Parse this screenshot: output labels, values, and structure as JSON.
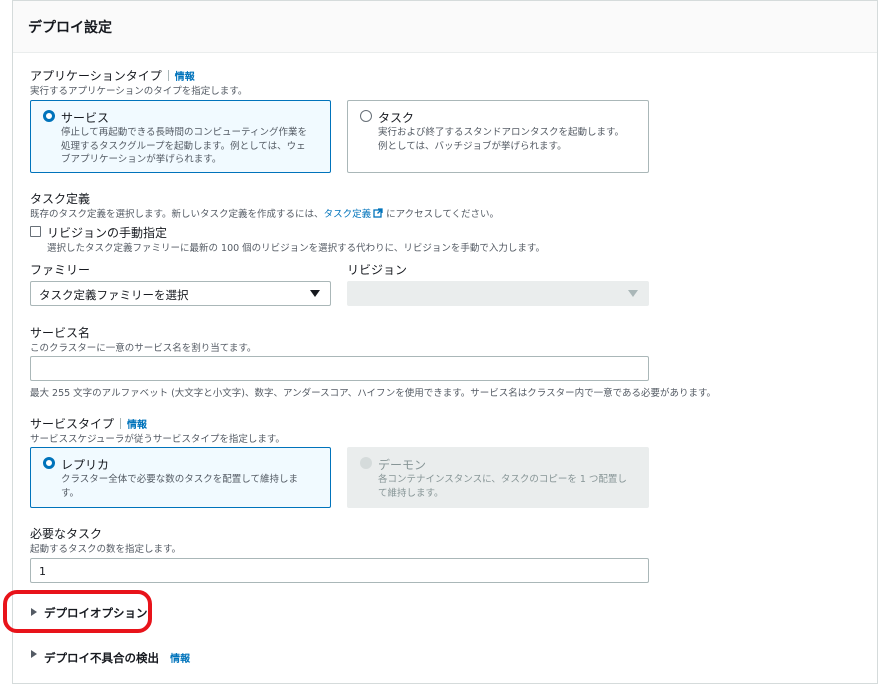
{
  "panel": {
    "title": "デプロイ設定"
  },
  "app_type": {
    "label": "アプリケーションタイプ",
    "info": "情報",
    "description": "実行するアプリケーションのタイプを指定します。",
    "options": [
      {
        "title": "サービス",
        "lines": [
          "停止して再起動できる長時間のコンピューティング作業を",
          "処理するタスクグループを起動します。例としては、ウェ",
          "ブアプリケーションが挙げられます。"
        ],
        "selected": true
      },
      {
        "title": "タスク",
        "lines": [
          "実行および終了するスタンドアロンタスクを起動します。",
          "例としては、バッチジョブが挙げられます。"
        ],
        "selected": false
      }
    ]
  },
  "task_def": {
    "label": "タスク定義",
    "description_before": "既存のタスク定義を選択します。新しいタスク定義を作成するには、",
    "link": "タスク定義",
    "description_after": "にアクセスしてください。",
    "manual_revision": {
      "label": "リビジョンの手動指定",
      "description": "選択したタスク定義ファミリーに最新の 100 個のリビジョンを選択する代わりに、リビジョンを手動で入力します。",
      "checked": false
    },
    "family_label": "ファミリー",
    "family_placeholder": "タスク定義ファミリーを選択",
    "revision_label": "リビジョン"
  },
  "service_name": {
    "label": "サービス名",
    "description": "このクラスターに一意のサービス名を割り当てます。",
    "value": "",
    "constraint": "最大 255 文字のアルファベット (大文字と小文字)、数字、アンダースコア、ハイフンを使用できます。サービス名はクラスター内で一意である必要があります。"
  },
  "service_type": {
    "label": "サービスタイプ",
    "info": "情報",
    "description": "サービススケジューラが従うサービスタイプを指定します。",
    "options": [
      {
        "title": "レプリカ",
        "lines": [
          "クラスター全体で必要な数のタスクを配置して維持しま",
          "す。"
        ],
        "selected": true
      },
      {
        "title": "デーモン",
        "lines": [
          "各コンテナインスタンスに、タスクのコピーを 1 つ配置し",
          "て維持します。"
        ],
        "selected": false,
        "disabled": true
      }
    ]
  },
  "desired_tasks": {
    "label": "必要なタスク",
    "description": "起動するタスクの数を指定します。",
    "value": "1"
  },
  "expanders": [
    {
      "label": "デプロイオプション",
      "expanded": false
    },
    {
      "label": "デプロイ不具合の検出",
      "info": "情報",
      "expanded": false
    }
  ],
  "colors": {
    "accent": "#0073bb",
    "annotation": "#e8131a"
  }
}
